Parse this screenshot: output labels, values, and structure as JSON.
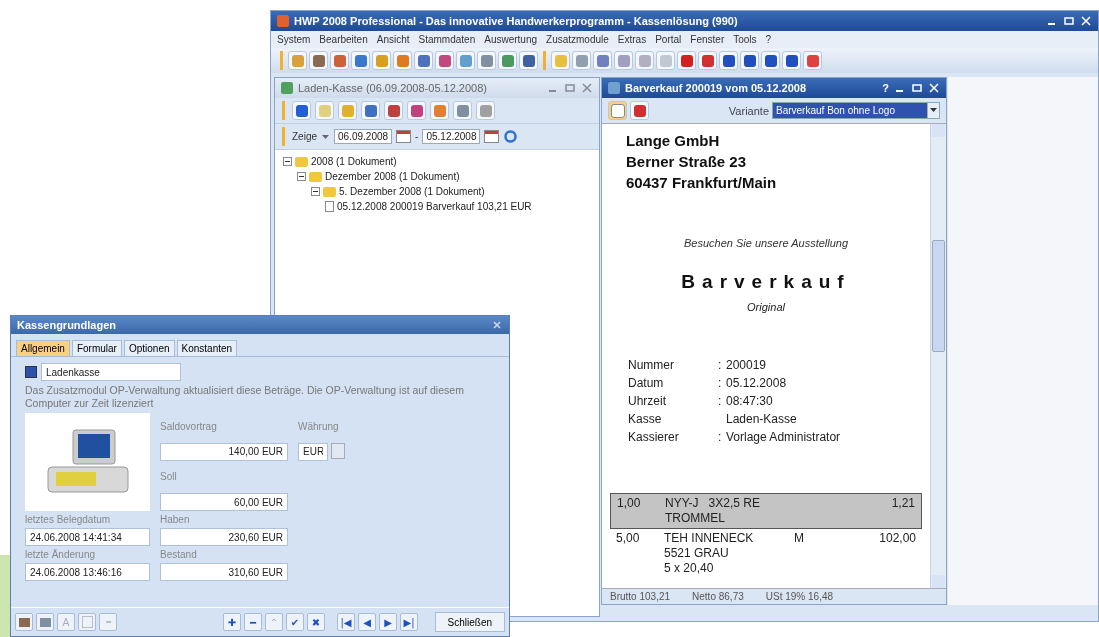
{
  "main_window": {
    "title": "HWP 2008 Professional - Das innovative Handwerkerprogramm - Kassenlösung (990)",
    "menu": [
      "System",
      "Bearbeiten",
      "Ansicht",
      "Stammdaten",
      "Auswertung",
      "Zusatzmodule",
      "Extras",
      "Portal",
      "Fenster",
      "Tools",
      "?"
    ]
  },
  "laden_kasse": {
    "title": "Laden-Kasse (06.09.2008-05.12.2008)",
    "filter_label": "Zeige",
    "date_from": "06.09.2008",
    "separator": "-",
    "date_to": "05.12.2008",
    "tree": [
      {
        "label": "2008 (1 Dokument)",
        "expanded": true,
        "children": [
          {
            "label": "Dezember 2008 (1 Dokument)",
            "expanded": true,
            "children": [
              {
                "label": "5. Dezember 2008 (1 Dokument)",
                "expanded": true,
                "children": [
                  {
                    "label": "05.12.2008 200019 Barverkauf 103,21 EUR",
                    "kind": "document"
                  }
                ]
              }
            ]
          }
        ]
      }
    ]
  },
  "receipt_window": {
    "title": "Barverkauf 200019 vom 05.12.2008",
    "help": "?",
    "variant_label": "Variante",
    "variant_value": "Barverkauf Bon ohne Logo",
    "company": [
      "Lange GmbH",
      "Berner Straße 23",
      "60437 Frankfurt/Main"
    ],
    "slogan": "Besuchen Sie unsere Ausstellung",
    "heading": "Barverkauf",
    "copy": "Original",
    "fields": [
      {
        "label": "Nummer",
        "sep": ":",
        "value": "200019"
      },
      {
        "label": "Datum",
        "sep": ":",
        "value": "05.12.2008"
      },
      {
        "label": "Uhrzeit",
        "sep": ":",
        "value": "08:47:30"
      },
      {
        "label": "Kasse",
        "value": "Laden-Kasse"
      },
      {
        "label": "Kassierer",
        "sep": ":",
        "value": "Vorlage Administrator"
      }
    ],
    "items": [
      {
        "qty": "1,00",
        "lines": [
          "NYY-J   3X2,5 RE",
          "TROMMEL"
        ],
        "price": "1,21",
        "selected": true
      },
      {
        "qty": "5,00",
        "lines": [
          "TEH INNENECK",
          "5521 GRAU",
          "5 x 20,40"
        ],
        "unit": "M",
        "price": "102,00",
        "selected": false
      }
    ],
    "status": [
      "Brutto 103,21",
      "Netto 86,73",
      "USt 19% 16,48"
    ]
  },
  "dialog": {
    "title": "Kassengrundlagen",
    "tabs": [
      {
        "label": "Allgemein",
        "selected": true
      },
      {
        "label": "Formular",
        "selected": false
      },
      {
        "label": "Optionen",
        "selected": false
      },
      {
        "label": "Konstanten",
        "selected": false
      }
    ],
    "name_value": "Ladenkasse",
    "info": "Das Zusatzmodul OP-Verwaltung aktualisiert diese Beträge. Die OP-Verwaltung ist auf diesem Computer zur Zeit lizenziert",
    "saldo_label": "Saldovortrag",
    "saldo": "140,00 EUR",
    "currency_label": "Währung",
    "currency": "EUR",
    "soll_label": "Soll",
    "soll": "60,00 EUR",
    "haben_label": "Haben",
    "haben": "230,60 EUR",
    "bestand_label": "Bestand",
    "bestand": "310,60 EUR",
    "last_doc_label": "letztes Belegdatum",
    "last_doc": "24.06.2008 14:41:34",
    "last_change_label": "letzte Änderung",
    "last_change": "24.06.2008 13:46:16",
    "letter_button": "A",
    "nav_buttons": [
      "✚",
      "━",
      "⌃",
      "✔",
      "✖",
      "|◀",
      "◀",
      "▶",
      "▶|"
    ],
    "close_button": "Schließen"
  }
}
